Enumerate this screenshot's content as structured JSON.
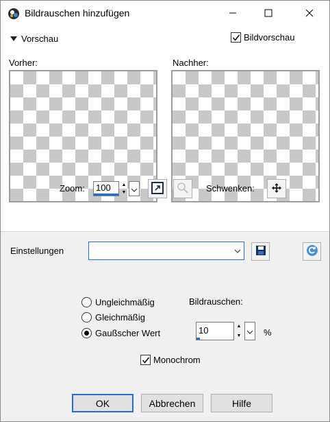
{
  "window": {
    "title": "Bildrauschen hinzufügen",
    "accent": "#1e6fd9"
  },
  "preview": {
    "toggle_label": "Vorschau",
    "image_preview_label": "Bildvorschau",
    "image_preview_checked": true,
    "before_label": "Vorher:",
    "after_label": "Nachher:",
    "zoom_label": "Zoom:",
    "zoom_value": "100",
    "pan_label": "Schwenken:"
  },
  "settings": {
    "label": "Einstellungen",
    "value": ""
  },
  "options": {
    "distribution": [
      {
        "label": "Ungleichmäßig",
        "selected": false
      },
      {
        "label": "Gleichmäßig",
        "selected": false
      },
      {
        "label": "Gaußscher Wert",
        "selected": true
      }
    ],
    "noise_label": "Bildrauschen:",
    "noise_value": "10",
    "noise_unit": "%",
    "monochrome_label": "Monochrom",
    "monochrome_checked": true
  },
  "buttons": {
    "ok": "OK",
    "cancel": "Abbrechen",
    "help": "Hilfe"
  },
  "icons": [
    "app-icon",
    "minimize-icon",
    "maximize-icon",
    "close-icon",
    "fit-to-window-icon",
    "zoom-to-actual-icon",
    "pan-icon",
    "save-preset-icon",
    "reset-icon"
  ]
}
